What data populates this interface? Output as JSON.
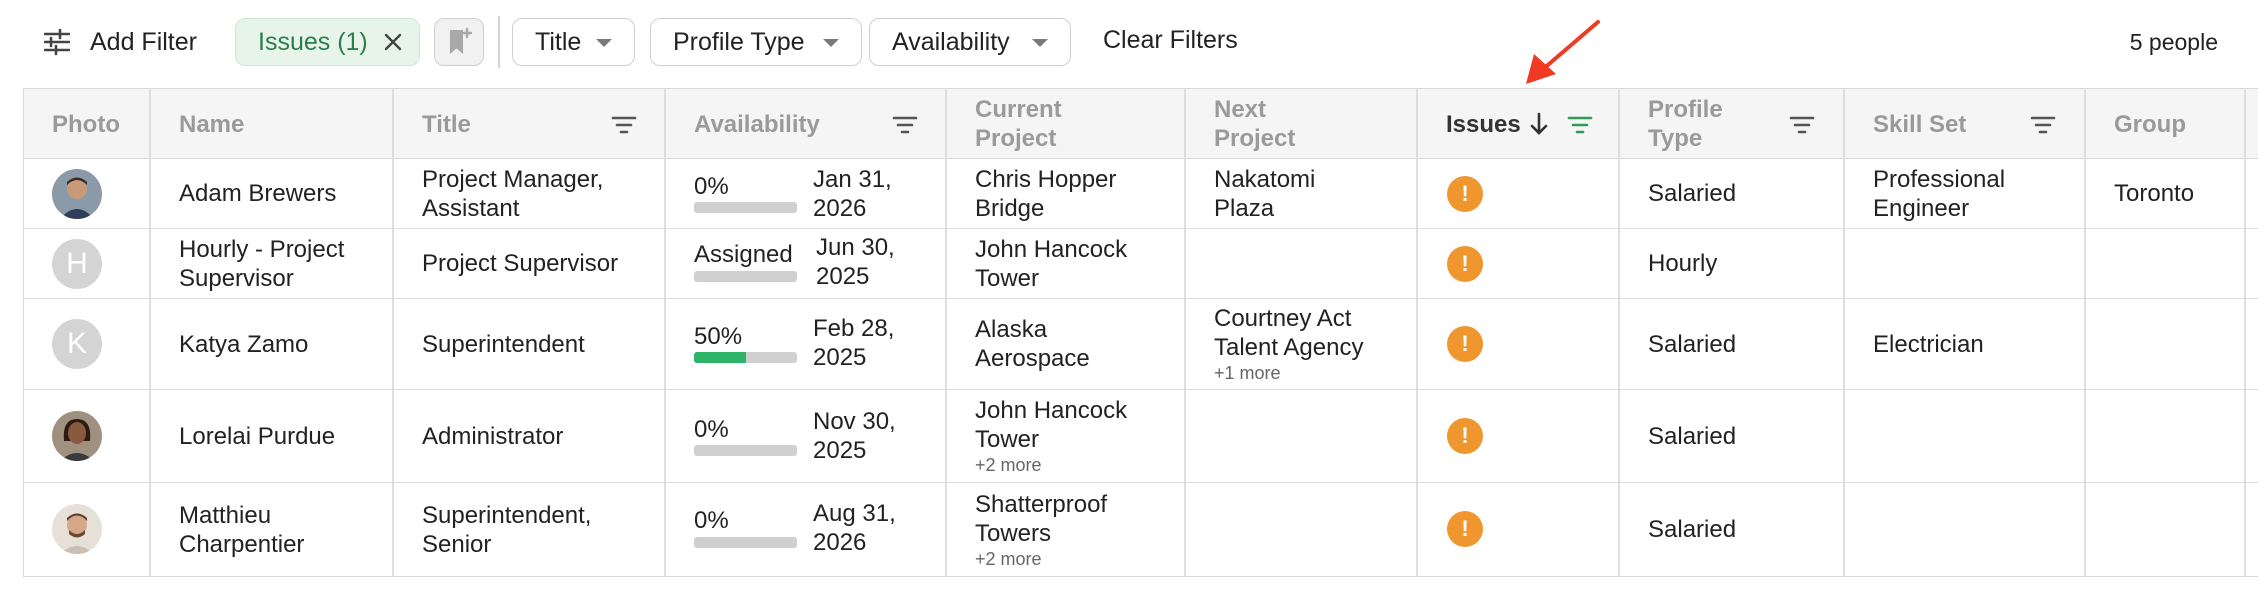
{
  "filterbar": {
    "add_filter_label": "Add Filter",
    "issues_chip_label": "Issues (1)",
    "title_dropdown": "Title",
    "profile_type_dropdown": "Profile Type",
    "availability_dropdown": "Availability",
    "clear_filters_label": "Clear Filters",
    "people_count": "5 people"
  },
  "columns": {
    "photo": "Photo",
    "name": "Name",
    "title": "Title",
    "availability": "Availability",
    "current_project_1": "Current",
    "current_project_2": "Project",
    "next_project_1": "Next",
    "next_project_2": "Project",
    "issues": "Issues",
    "profile_type_1": "Profile",
    "profile_type_2": "Type",
    "skill_set": "Skill Set",
    "group": "Group"
  },
  "rows": [
    {
      "avatar": "photo",
      "name_1": "Adam Brewers",
      "name_2": "",
      "title_1": "Project Manager,",
      "title_2": "Assistant",
      "availability": "0%",
      "availability_pct": 0,
      "date_1": "Jan 31,",
      "date_2": "2026",
      "current_project_1": "Chris Hopper",
      "current_project_2": "Bridge",
      "current_more": "",
      "next_project_1": "Nakatomi",
      "next_project_2": "Plaza",
      "next_more": "",
      "issue_icon": "!",
      "profile_type": "Salaried",
      "skill_1": "Professional",
      "skill_2": "Engineer",
      "group": "Toronto"
    },
    {
      "avatar": "H",
      "name_1": "Hourly - Project",
      "name_2": "Supervisor",
      "title_1": "Project Supervisor",
      "title_2": "",
      "availability": "Assigned",
      "availability_pct": 0,
      "date_1": "Jun 30,",
      "date_2": "2025",
      "current_project_1": "John Hancock",
      "current_project_2": "Tower",
      "current_more": "",
      "next_project_1": "",
      "next_project_2": "",
      "next_more": "",
      "issue_icon": "!",
      "profile_type": "Hourly",
      "skill_1": "",
      "skill_2": "",
      "group": ""
    },
    {
      "avatar": "K",
      "name_1": "Katya Zamo",
      "name_2": "",
      "title_1": "Superintendent",
      "title_2": "",
      "availability": "50%",
      "availability_pct": 50,
      "date_1": "Feb 28,",
      "date_2": "2025",
      "current_project_1": "Alaska",
      "current_project_2": "Aerospace",
      "current_more": "",
      "next_project_1": "Courtney Act",
      "next_project_2": "Talent Agency",
      "next_more": "+1 more",
      "issue_icon": "!",
      "profile_type": "Salaried",
      "skill_1": "Electrician",
      "skill_2": "",
      "group": ""
    },
    {
      "avatar": "photo",
      "name_1": "Lorelai Purdue",
      "name_2": "",
      "title_1": "Administrator",
      "title_2": "",
      "availability": "0%",
      "availability_pct": 0,
      "date_1": "Nov 30,",
      "date_2": "2025",
      "current_project_1": "John Hancock",
      "current_project_2": "Tower",
      "current_more": "+2 more",
      "next_project_1": "",
      "next_project_2": "",
      "next_more": "",
      "issue_icon": "!",
      "profile_type": "Salaried",
      "skill_1": "",
      "skill_2": "",
      "group": ""
    },
    {
      "avatar": "photo",
      "name_1": "Matthieu",
      "name_2": "Charpentier",
      "title_1": "Superintendent,",
      "title_2": "Senior",
      "availability": "0%",
      "availability_pct": 0,
      "date_1": "Aug 31,",
      "date_2": "2026",
      "current_project_1": "Shatterproof",
      "current_project_2": "Towers",
      "current_more": "+2 more",
      "next_project_1": "",
      "next_project_2": "",
      "next_more": "",
      "issue_icon": "!",
      "profile_type": "Salaried",
      "skill_1": "",
      "skill_2": "",
      "group": ""
    }
  ],
  "colors": {
    "chip_bg": "#e6f4e9",
    "chip_text": "#2e7d4f",
    "issue_orange": "#f0962f",
    "progress_green": "#2db36a",
    "annotation_red": "#f03a24"
  },
  "icons": {
    "add_filter": "sliders-icon",
    "chip_remove": "close-icon",
    "bookmark": "bookmark-add-icon",
    "sort": "arrow-down-icon",
    "column_filter": "filter-lines-icon",
    "issue": "exclamation-circle-icon"
  }
}
